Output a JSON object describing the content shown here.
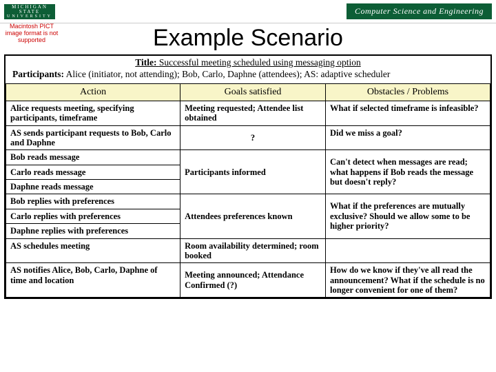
{
  "header": {
    "msu_line1": "MICHIGAN STATE",
    "msu_line2": "UNIVERSITY",
    "cse": "Computer Science and Engineering",
    "missing": "Macintosh PICT image format is not supported"
  },
  "slide_title": "Example Scenario",
  "intro": {
    "title_label": "Title:",
    "title_value": "Successful meeting scheduled using messaging option",
    "participants_label": "Participants:",
    "participants_value": "Alice (initiator, not attending); Bob, Carlo, Daphne (attendees); AS: adaptive scheduler"
  },
  "columns": {
    "action": "Action",
    "goals": "Goals satisfied",
    "obstacles": "Obstacles / Problems"
  },
  "rows": {
    "r1": {
      "action": "Alice requests meeting, specifying participants, timeframe",
      "goals": "Meeting requested; Attendee list obtained",
      "obs": "What if selected timeframe is infeasible?"
    },
    "r2": {
      "action": "AS sends participant requests to Bob, Carlo and Daphne",
      "goals": "?",
      "obs": "Did we miss a goal?"
    },
    "r3a": {
      "action": "Bob reads message"
    },
    "r3b": {
      "action": "Carlo reads message"
    },
    "r3c": {
      "action": "Daphne reads message"
    },
    "r3goals": "Participants informed",
    "r3obs": "Can't detect when messages are read; what happens if Bob reads the message but doesn't reply?",
    "r4a": {
      "action": "Bob replies with preferences"
    },
    "r4b": {
      "action": "Carlo replies with preferences"
    },
    "r4c": {
      "action": "Daphne replies with preferences"
    },
    "r4goals": "Attendees preferences known",
    "r4obs": "What if the preferences are mutually exclusive? Should we allow some to be higher priority?",
    "r5": {
      "action": "AS schedules meeting",
      "goals": "Room availability determined; room booked",
      "obs": ""
    },
    "r6": {
      "action": "AS notifies Alice, Bob, Carlo, Daphne of time and location",
      "goals": "Meeting announced; Attendance Confirmed (?)",
      "obs": "How do we know if they've all read the announcement? What if the schedule is no longer convenient for one of them?"
    }
  }
}
